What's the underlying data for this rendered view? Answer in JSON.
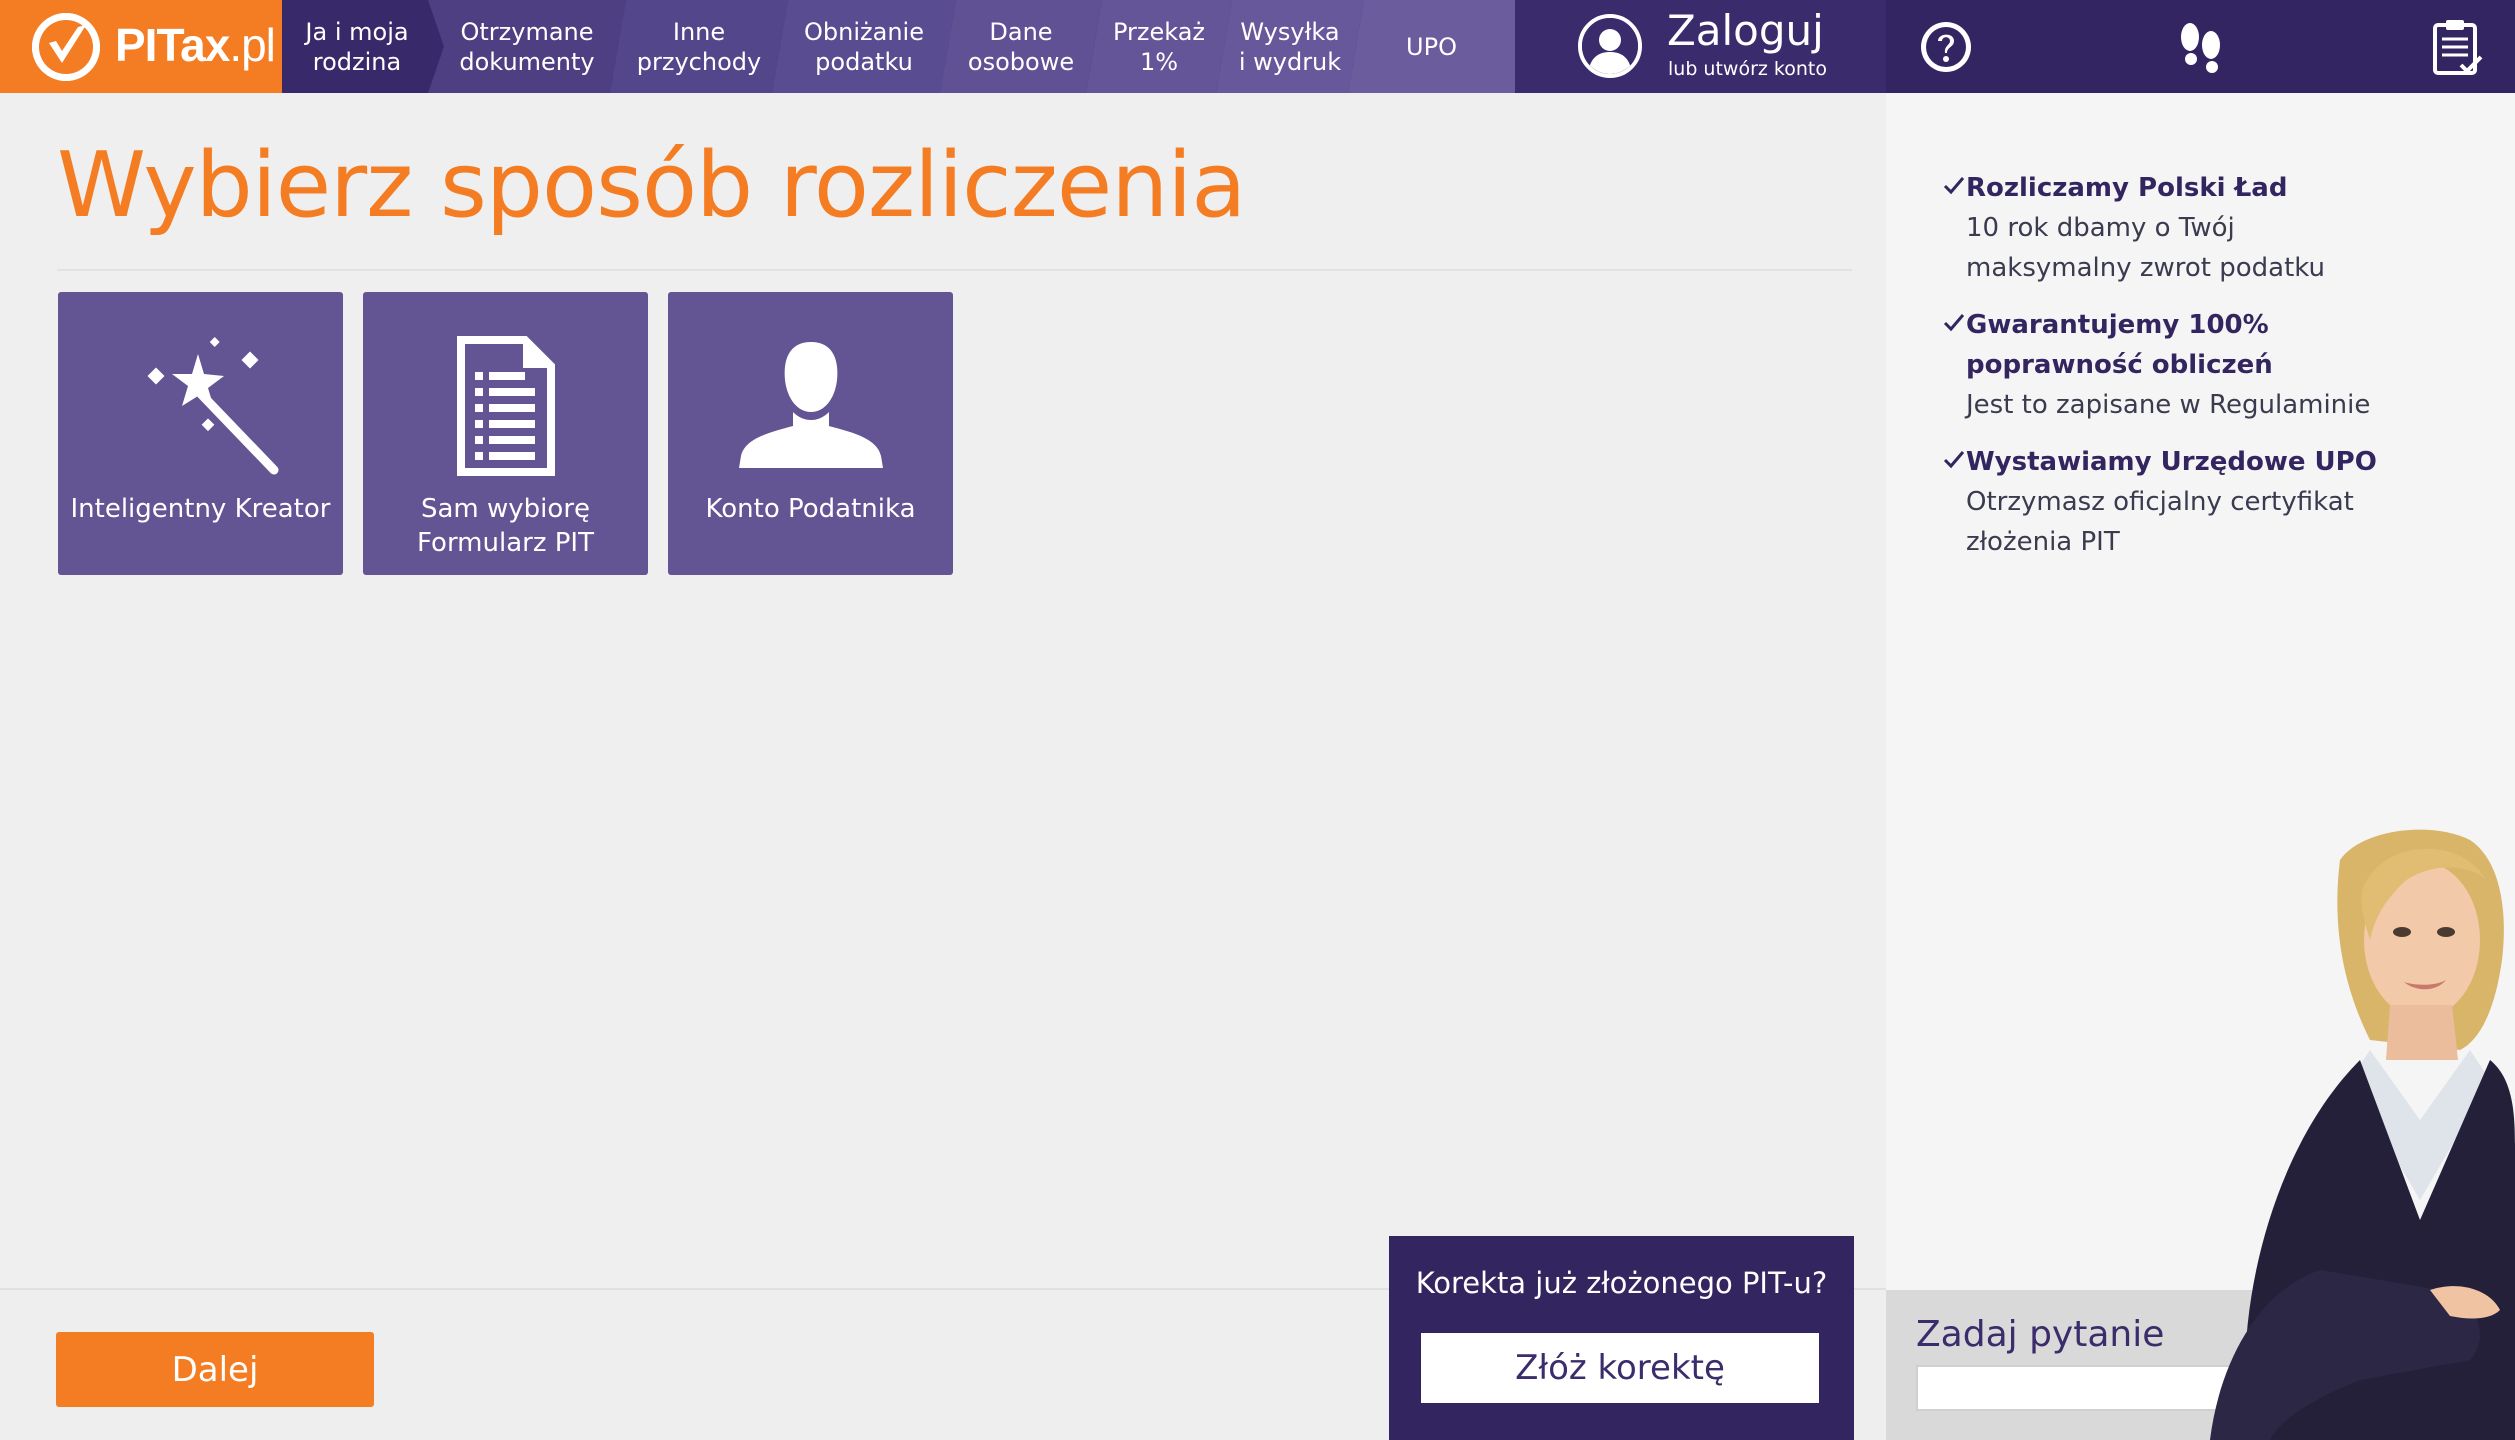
{
  "brand": {
    "name_bold": "PITax",
    "name_light": ".pl",
    "accent": "#f47c22",
    "primary": "#382a6a",
    "tile_color": "#635594"
  },
  "steps": [
    {
      "label": "Ja i moja\nrodzina"
    },
    {
      "label": "Otrzymane\ndokumenty"
    },
    {
      "label": "Inne\nprzychody"
    },
    {
      "label": "Obniżanie\npodatku"
    },
    {
      "label": "Dane\nosobowe"
    },
    {
      "label": "Przekaż\n1%"
    },
    {
      "label": "Wysyłka\ni wydruk"
    },
    {
      "label": "UPO"
    }
  ],
  "login": {
    "title": "Zaloguj",
    "subtitle": "lub utwórz konto"
  },
  "tools": {
    "help_icon": "question-icon",
    "steps_icon": "footprints-icon",
    "clipboard_icon": "clipboard-icon"
  },
  "main": {
    "title": "Wybierz sposób rozliczenia",
    "options": [
      {
        "label": "Inteligentny Kreator",
        "icon": "magic-wand-icon"
      },
      {
        "label": "Sam wybiorę\nFormularz PIT",
        "icon": "document-icon"
      },
      {
        "label": "Konto Podatnika",
        "icon": "user-icon"
      }
    ]
  },
  "footer": {
    "next_label": "Dalej",
    "correction_question": "Korekta już złożonego PIT-u?",
    "correction_button": "Złóż korektę"
  },
  "sidebar": {
    "benefits": [
      {
        "title": "Rozliczamy Polski Ład",
        "desc": "10 rok dbamy o Twój\nmaksymalny zwrot podatku"
      },
      {
        "title": "Gwarantujemy 100%\npoprawność obliczeń",
        "desc": "Jest to zapisane w Regulaminie"
      },
      {
        "title": "Wystawiamy Urzędowe UPO",
        "desc": "Otrzymasz oficjalny certyfikat\nzłożenia PIT"
      }
    ],
    "ask_title": "Zadaj pytanie",
    "ask_value": ""
  }
}
